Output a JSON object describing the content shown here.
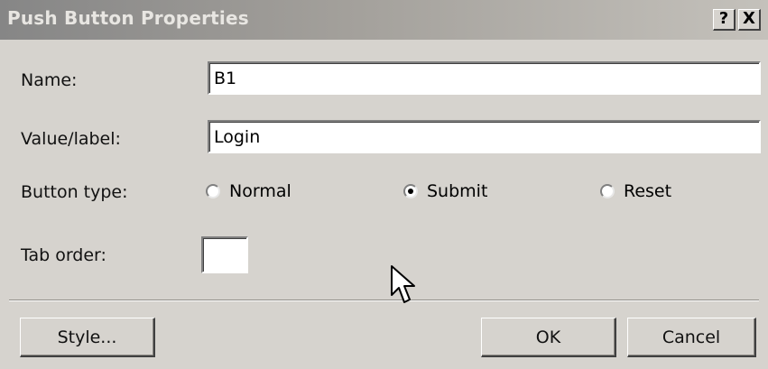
{
  "dialog": {
    "title": "Push Button Properties",
    "help_label": "?",
    "close_label": "X"
  },
  "fields": {
    "name_label": "Name:",
    "name_value": "B1",
    "value_label": "Value/label:",
    "value_value": "Login",
    "button_type_label": "Button type:",
    "tab_order_label": "Tab order:",
    "tab_order_value": ""
  },
  "button_type": {
    "options": [
      "Normal",
      "Submit",
      "Reset"
    ],
    "selected": "Submit"
  },
  "buttons": {
    "style_label": "Style...",
    "ok_label": "OK",
    "cancel_label": "Cancel"
  },
  "icons": {
    "cursor": "mouse-pointer-icon",
    "help": "help-icon",
    "close": "close-icon"
  }
}
